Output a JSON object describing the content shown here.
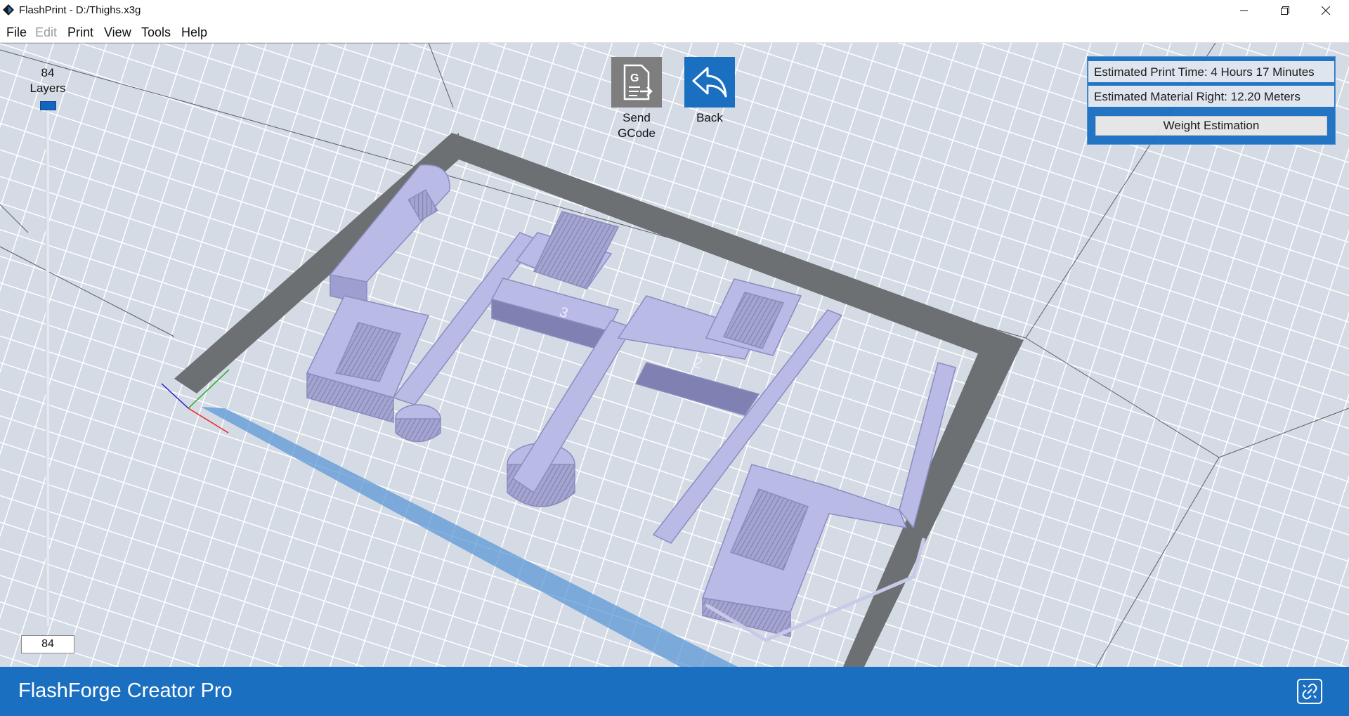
{
  "window": {
    "title": "FlashPrint - D:/Thighs.x3g"
  },
  "menu": [
    "File",
    "Edit",
    "Print",
    "View",
    "Tools",
    "Help"
  ],
  "menu_disabled": [
    "Edit"
  ],
  "layers": {
    "count": "84",
    "label": "Layers",
    "current": "84",
    "level": 1.0
  },
  "toolbar": {
    "send_gcode_label": "Send\nGCode",
    "back_label": "Back"
  },
  "estimate": {
    "print_time": "Estimated Print Time: 4 Hours 17 Minutes",
    "material": "Estimated Material Right: 12.20 Meters",
    "weight_button": "Weight Estimation"
  },
  "model_labels": [
    "3",
    "2"
  ],
  "status": {
    "printer": "FlashForge Creator Pro"
  },
  "colors": {
    "accent": "#1a6fc1",
    "model": "#b9bbe6",
    "bed": "#d3dae4",
    "frame": "#6d7072"
  },
  "icons": {
    "app": "flashprint-logo-icon",
    "send_gcode": "send-gcode-icon",
    "back": "back-arrow-icon",
    "connect": "link-icon"
  }
}
